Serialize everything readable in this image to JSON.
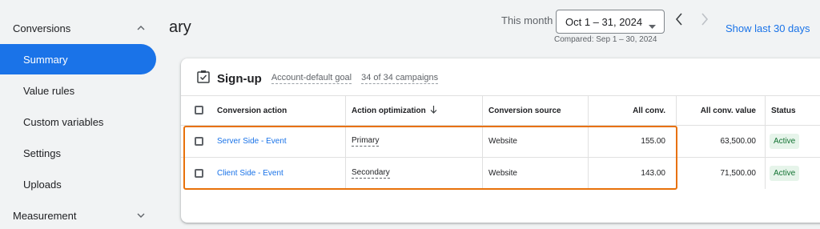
{
  "sidebar": {
    "section_conversions": "Conversions",
    "items": [
      {
        "label": "Summary"
      },
      {
        "label": "Value rules"
      },
      {
        "label": "Custom variables"
      },
      {
        "label": "Settings"
      },
      {
        "label": "Uploads"
      }
    ],
    "section_measurement": "Measurement"
  },
  "header": {
    "title": "ary",
    "period_label": "This month",
    "date_range": "Oct 1 – 31, 2024",
    "compared": "Compared: Sep 1 – 30, 2024",
    "show_last": "Show last 30 days"
  },
  "goal": {
    "name": "Sign-up",
    "goal_type": "Account-default goal",
    "campaigns": "34 of 34 campaigns"
  },
  "table": {
    "columns": {
      "action": "Conversion action",
      "optimization": "Action optimization",
      "source": "Conversion source",
      "all_conv": "All conv.",
      "all_conv_value": "All conv. value",
      "status": "Status"
    },
    "rows": [
      {
        "action": "Server Side - Event",
        "optimization": "Primary",
        "source": "Website",
        "all_conv": "155.00",
        "all_conv_value": "63,500.00",
        "status": "Active"
      },
      {
        "action": "Client Side - Event",
        "optimization": "Secondary",
        "source": "Website",
        "all_conv": "143.00",
        "all_conv_value": "71,500.00",
        "status": "Active"
      }
    ]
  },
  "colors": {
    "accent": "#1a73e8",
    "highlight": "#e8710a",
    "active_badge_bg": "#e6f4ea",
    "active_badge_text": "#137333"
  }
}
